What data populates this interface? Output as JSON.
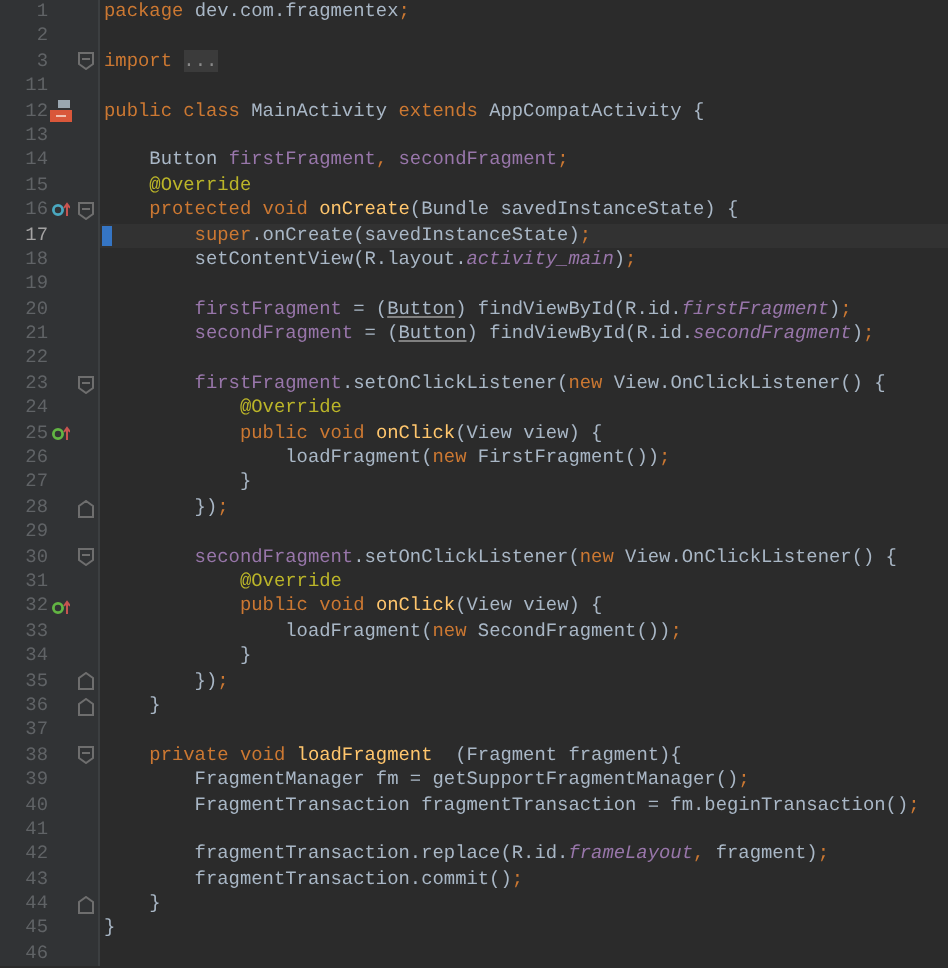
{
  "editor": {
    "lines": [
      {
        "number": "1",
        "tokens": [
          {
            "kind": "kw",
            "text": "package"
          },
          {
            "kind": "plain",
            "text": " dev.com.fragmentex"
          },
          {
            "kind": "kw",
            "text": ";"
          }
        ]
      },
      {
        "number": "2"
      },
      {
        "number": "3",
        "fold_marker": {
          "kind": "start"
        },
        "tokens": [
          {
            "kind": "kw",
            "text": "import "
          },
          {
            "kind": "folded",
            "text": "..."
          }
        ]
      },
      {
        "number": "11"
      },
      {
        "number": "12",
        "gutter_marker": {
          "kind": "class"
        },
        "tokens": [
          {
            "kind": "kw",
            "text": "public class "
          },
          {
            "kind": "plain",
            "text": "MainActivity "
          },
          {
            "kind": "kw",
            "text": "extends "
          },
          {
            "kind": "plain",
            "text": "AppCompatActivity {"
          }
        ]
      },
      {
        "number": "13"
      },
      {
        "number": "14",
        "tokens": [
          {
            "kind": "plain",
            "text": "    Button "
          },
          {
            "kind": "field",
            "text": "firstFragment"
          },
          {
            "kind": "kw",
            "text": ", "
          },
          {
            "kind": "field",
            "text": "secondFragment"
          },
          {
            "kind": "kw",
            "text": ";"
          }
        ]
      },
      {
        "number": "15",
        "tokens": [
          {
            "kind": "ann",
            "text": "    @Override"
          }
        ]
      },
      {
        "number": "16",
        "gutter_marker": {
          "kind": "overrides"
        },
        "fold_marker": {
          "kind": "start"
        },
        "tokens": [
          {
            "kind": "kw",
            "text": "    protected void "
          },
          {
            "kind": "fn",
            "text": "onCreate"
          },
          {
            "kind": "plain",
            "text": "(Bundle savedInstanceState) {"
          }
        ]
      },
      {
        "number": "17",
        "current": true,
        "changed": true,
        "tokens": [
          {
            "kind": "kw",
            "text": "        super"
          },
          {
            "kind": "plain",
            "text": ".onCreate(savedInstanceState)"
          },
          {
            "kind": "kw",
            "text": ";"
          }
        ]
      },
      {
        "number": "18",
        "tokens": [
          {
            "kind": "plain",
            "text": "        setContentView(R.layout."
          },
          {
            "kind": "static",
            "text": "activity_main"
          },
          {
            "kind": "plain",
            "text": ")"
          },
          {
            "kind": "kw",
            "text": ";"
          }
        ]
      },
      {
        "number": "19"
      },
      {
        "number": "20",
        "tokens": [
          {
            "kind": "field",
            "text": "        firstFragment"
          },
          {
            "kind": "plain",
            "text": " = ("
          },
          {
            "kind": "cast",
            "text": "Button"
          },
          {
            "kind": "plain",
            "text": ") findViewById(R.id."
          },
          {
            "kind": "static",
            "text": "firstFragment"
          },
          {
            "kind": "plain",
            "text": ")"
          },
          {
            "kind": "kw",
            "text": ";"
          }
        ]
      },
      {
        "number": "21",
        "tokens": [
          {
            "kind": "field",
            "text": "        secondFragment"
          },
          {
            "kind": "plain",
            "text": " = ("
          },
          {
            "kind": "cast",
            "text": "Button"
          },
          {
            "kind": "plain",
            "text": ") findViewById(R.id."
          },
          {
            "kind": "static",
            "text": "secondFragment"
          },
          {
            "kind": "plain",
            "text": ")"
          },
          {
            "kind": "kw",
            "text": ";"
          }
        ]
      },
      {
        "number": "22"
      },
      {
        "number": "23",
        "fold_marker": {
          "kind": "start"
        },
        "tokens": [
          {
            "kind": "field",
            "text": "        firstFragment"
          },
          {
            "kind": "plain",
            "text": ".setOnClickListener("
          },
          {
            "kind": "kw",
            "text": "new "
          },
          {
            "kind": "plain",
            "text": "View.OnClickListener() {"
          }
        ]
      },
      {
        "number": "24",
        "tokens": [
          {
            "kind": "ann",
            "text": "            @Override"
          }
        ]
      },
      {
        "number": "25",
        "gutter_marker": {
          "kind": "implements"
        },
        "tokens": [
          {
            "kind": "kw",
            "text": "            public void "
          },
          {
            "kind": "fn",
            "text": "onClick"
          },
          {
            "kind": "plain",
            "text": "(View view) {"
          }
        ]
      },
      {
        "number": "26",
        "tokens": [
          {
            "kind": "plain",
            "text": "                loadFragment("
          },
          {
            "kind": "kw",
            "text": "new "
          },
          {
            "kind": "plain",
            "text": "FirstFragment())"
          },
          {
            "kind": "kw",
            "text": ";"
          }
        ]
      },
      {
        "number": "27",
        "tokens": [
          {
            "kind": "plain",
            "text": "            }"
          }
        ]
      },
      {
        "number": "28",
        "fold_marker": {
          "kind": "end"
        },
        "tokens": [
          {
            "kind": "plain",
            "text": "        })"
          },
          {
            "kind": "kw",
            "text": ";"
          }
        ]
      },
      {
        "number": "29"
      },
      {
        "number": "30",
        "fold_marker": {
          "kind": "start"
        },
        "tokens": [
          {
            "kind": "field",
            "text": "        secondFragment"
          },
          {
            "kind": "plain",
            "text": ".setOnClickListener("
          },
          {
            "kind": "kw",
            "text": "new "
          },
          {
            "kind": "plain",
            "text": "View.OnClickListener() {"
          }
        ]
      },
      {
        "number": "31",
        "tokens": [
          {
            "kind": "ann",
            "text": "            @Override"
          }
        ]
      },
      {
        "number": "32",
        "gutter_marker": {
          "kind": "implements"
        },
        "tokens": [
          {
            "kind": "kw",
            "text": "            public void "
          },
          {
            "kind": "fn",
            "text": "onClick"
          },
          {
            "kind": "plain",
            "text": "(View view) {"
          }
        ]
      },
      {
        "number": "33",
        "tokens": [
          {
            "kind": "plain",
            "text": "                loadFragment("
          },
          {
            "kind": "kw",
            "text": "new "
          },
          {
            "kind": "plain",
            "text": "SecondFragment())"
          },
          {
            "kind": "kw",
            "text": ";"
          }
        ]
      },
      {
        "number": "34",
        "tokens": [
          {
            "kind": "plain",
            "text": "            }"
          }
        ]
      },
      {
        "number": "35",
        "fold_marker": {
          "kind": "end"
        },
        "tokens": [
          {
            "kind": "plain",
            "text": "        })"
          },
          {
            "kind": "kw",
            "text": ";"
          }
        ]
      },
      {
        "number": "36",
        "fold_marker": {
          "kind": "end"
        },
        "tokens": [
          {
            "kind": "plain",
            "text": "    }"
          }
        ]
      },
      {
        "number": "37"
      },
      {
        "number": "38",
        "fold_marker": {
          "kind": "start"
        },
        "tokens": [
          {
            "kind": "kw",
            "text": "    private void "
          },
          {
            "kind": "fn",
            "text": "loadFragment"
          },
          {
            "kind": "plain",
            "text": "  (Fragment fragment){"
          }
        ]
      },
      {
        "number": "39",
        "tokens": [
          {
            "kind": "plain",
            "text": "        FragmentManager fm = getSupportFragmentManager()"
          },
          {
            "kind": "kw",
            "text": ";"
          }
        ]
      },
      {
        "number": "40",
        "tokens": [
          {
            "kind": "plain",
            "text": "        FragmentTransaction fragmentTransaction = fm.beginTransaction()"
          },
          {
            "kind": "kw",
            "text": ";"
          }
        ]
      },
      {
        "number": "41"
      },
      {
        "number": "42",
        "tokens": [
          {
            "kind": "plain",
            "text": "        fragmentTransaction.replace(R.id."
          },
          {
            "kind": "static",
            "text": "frameLayout"
          },
          {
            "kind": "kw",
            "text": ", "
          },
          {
            "kind": "plain",
            "text": "fragment)"
          },
          {
            "kind": "kw",
            "text": ";"
          }
        ]
      },
      {
        "number": "43",
        "tokens": [
          {
            "kind": "plain",
            "text": "        fragmentTransaction.commit()"
          },
          {
            "kind": "kw",
            "text": ";"
          }
        ]
      },
      {
        "number": "44",
        "fold_marker": {
          "kind": "end"
        },
        "tokens": [
          {
            "kind": "plain",
            "text": "    }"
          }
        ]
      },
      {
        "number": "45",
        "tokens": [
          {
            "kind": "plain",
            "text": "}"
          }
        ]
      },
      {
        "number": "46"
      }
    ]
  }
}
